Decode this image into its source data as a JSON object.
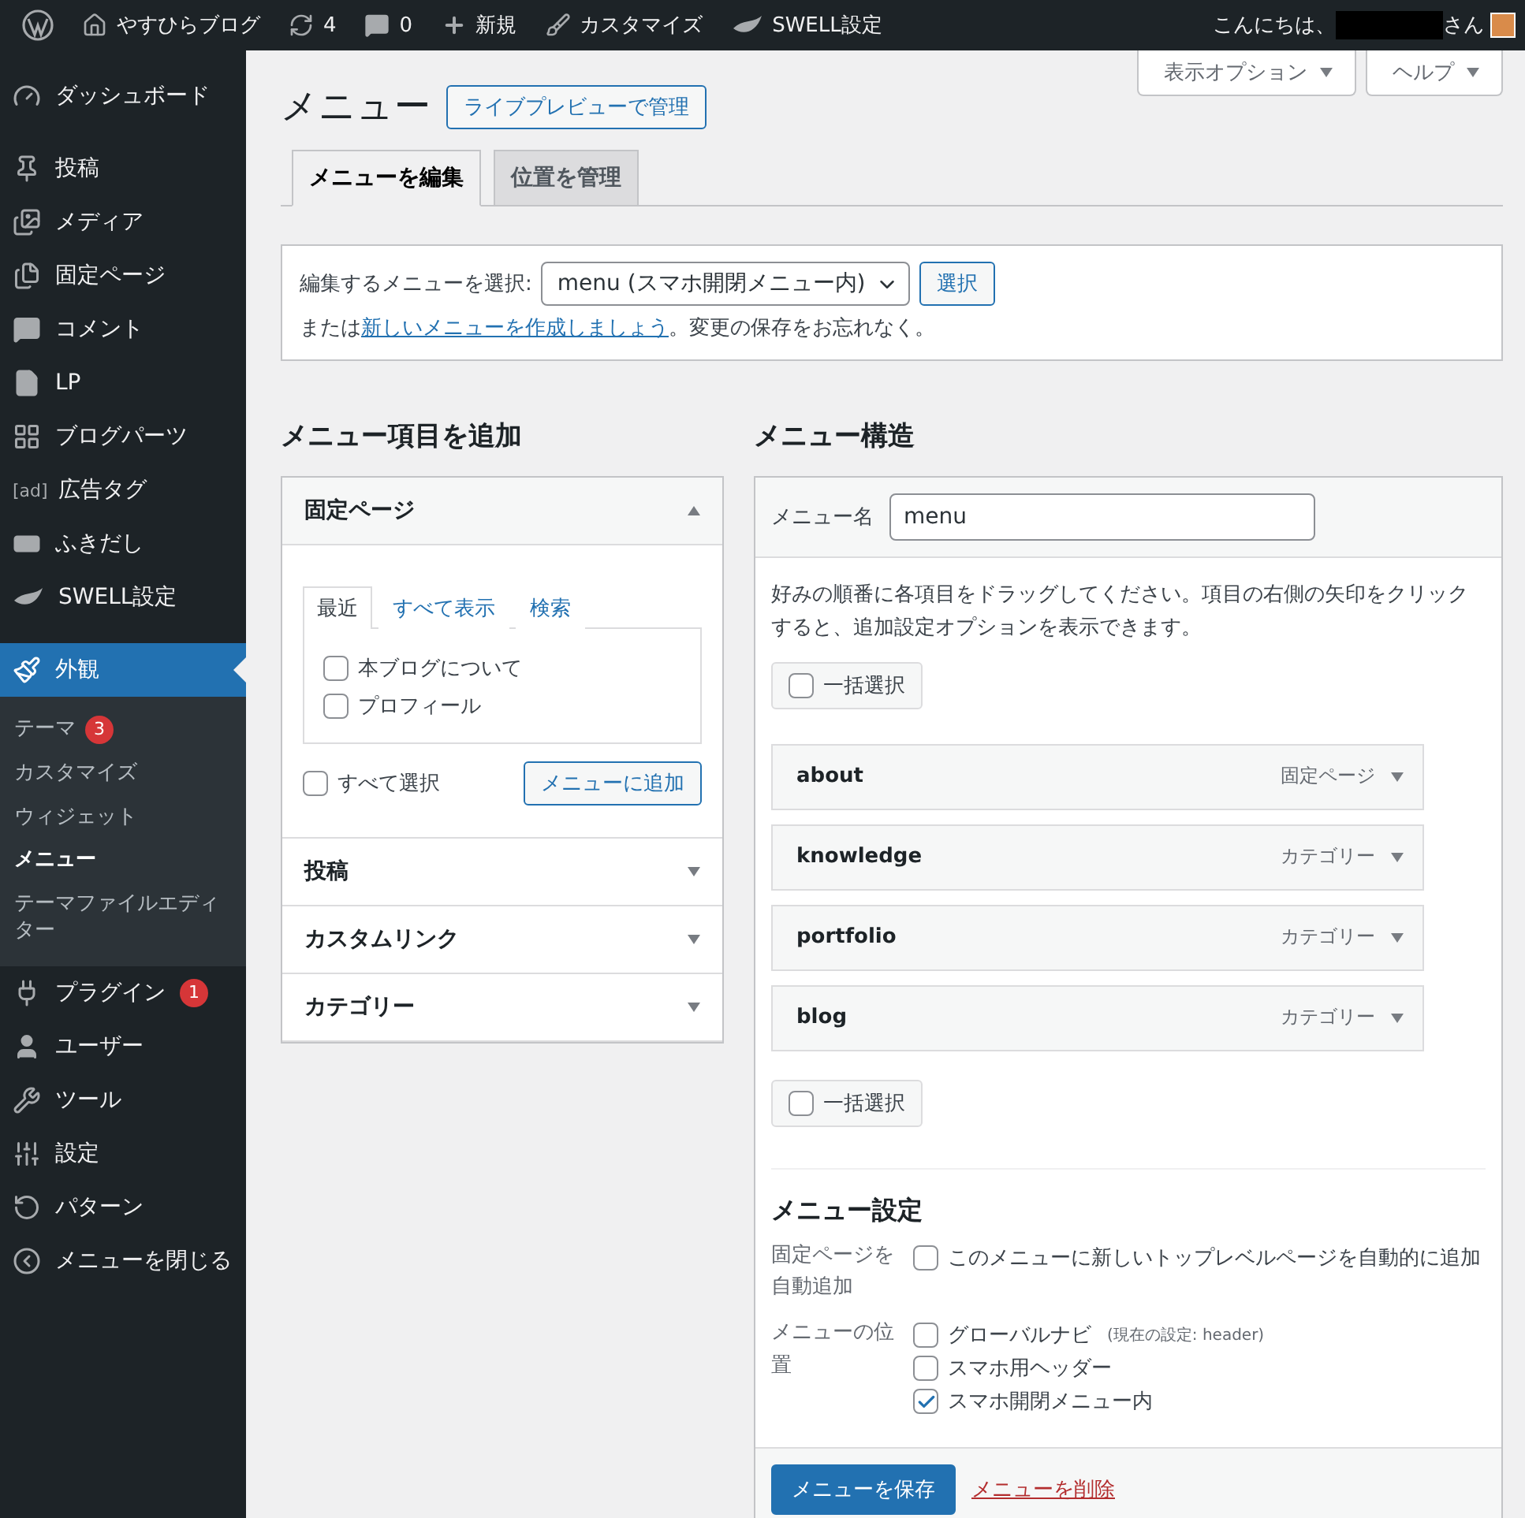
{
  "admin_bar": {
    "items": [
      {
        "kind": "site",
        "label": "やすひらブログ"
      },
      {
        "kind": "updates",
        "label": "4"
      },
      {
        "kind": "comments",
        "label": "0"
      },
      {
        "kind": "new",
        "label": "新規"
      },
      {
        "kind": "customize",
        "label": "カスタマイズ"
      },
      {
        "kind": "swell",
        "label": "SWELL設定"
      }
    ],
    "greeting": {
      "prefix": "こんにちは、",
      "suffix": "さん"
    }
  },
  "sidebar": {
    "sections": [
      {
        "items": [
          {
            "kind": "dashboard",
            "label": "ダッシュボード",
            "selected": false
          }
        ]
      },
      {
        "items": [
          {
            "kind": "posts",
            "label": "投稿",
            "selected": false
          },
          {
            "kind": "media",
            "label": "メディア",
            "selected": false
          },
          {
            "kind": "pages",
            "label": "固定ページ",
            "selected": false
          },
          {
            "kind": "comments",
            "label": "コメント",
            "selected": false
          },
          {
            "kind": "lp",
            "label": "LP",
            "selected": false
          },
          {
            "kind": "blog_parts",
            "label": "ブログパーツ",
            "selected": false
          },
          {
            "kind": "ad",
            "icon_text": "[ad]",
            "label": "広告タグ",
            "selected": false
          },
          {
            "kind": "balloon",
            "label": "ふきだし",
            "selected": false
          },
          {
            "kind": "swell",
            "label": "SWELL設定",
            "selected": false
          }
        ]
      },
      {
        "items": [
          {
            "kind": "appearance",
            "label": "外観",
            "selected": true,
            "children": [
              {
                "label": "テーマ",
                "badge": "3",
                "selected": false
              },
              {
                "label": "カスタマイズ",
                "selected": false
              },
              {
                "label": "ウィジェット",
                "selected": false
              },
              {
                "label": "メニュー",
                "selected": true
              },
              {
                "label": "テーマファイルエディター",
                "selected": false
              }
            ]
          },
          {
            "kind": "plugins",
            "label": "プラグイン",
            "badge": "1",
            "selected": false
          },
          {
            "kind": "users",
            "label": "ユーザー",
            "selected": false
          },
          {
            "kind": "tools",
            "label": "ツール",
            "selected": false
          },
          {
            "kind": "settings",
            "label": "設定",
            "selected": false
          },
          {
            "kind": "patterns",
            "label": "パターン",
            "selected": false
          },
          {
            "kind": "collapse",
            "label": "メニューを閉じる",
            "selected": false
          }
        ]
      }
    ]
  },
  "top_buttons": [
    "表示オプション",
    "ヘルプ"
  ],
  "page_title": "メニュー",
  "live_preview_button": "ライブプレビューで管理",
  "tabs": [
    {
      "label": "メニューを編集",
      "selected": true
    },
    {
      "label": "位置を管理",
      "selected": false
    }
  ],
  "select_panel": {
    "label": "編集するメニューを選択:",
    "select_value": "menu (スマホ開閉メニュー内)",
    "button": "選択",
    "note_prefix": "または",
    "note_link": "新しいメニューを作成しましょう",
    "note_suffix": "。変更の保存をお忘れなく。"
  },
  "add_items": {
    "heading": "メニュー項目を追加",
    "sections": [
      {
        "title": "固定ページ",
        "expanded": true,
        "tabs": [
          {
            "label": "最近",
            "selected": true
          },
          {
            "label": "すべて表示",
            "selected": false
          },
          {
            "label": "検索",
            "selected": false
          }
        ],
        "items": [
          {
            "label": "本ブログについて",
            "checked": false
          },
          {
            "label": "プロフィール",
            "checked": false
          }
        ],
        "select_all": {
          "label": "すべて選択",
          "checked": false
        },
        "add_button": "メニューに追加"
      },
      {
        "title": "投稿",
        "expanded": false
      },
      {
        "title": "カスタムリンク",
        "expanded": false
      },
      {
        "title": "カテゴリー",
        "expanded": false
      }
    ]
  },
  "structure": {
    "heading": "メニュー構造",
    "name_label": "メニュー名",
    "name_value": "menu",
    "instructions": "好みの順番に各項目をドラッグしてください。項目の右側の矢印をクリックすると、追加設定オプションを表示できます。",
    "bulk_select_top": {
      "label": "一括選択",
      "checked": false
    },
    "items": [
      {
        "title": "about",
        "type": "固定ページ"
      },
      {
        "title": "knowledge",
        "type": "カテゴリー"
      },
      {
        "title": "portfolio",
        "type": "カテゴリー"
      },
      {
        "title": "blog",
        "type": "カテゴリー"
      }
    ],
    "bulk_select_bottom": {
      "label": "一括選択",
      "checked": false
    },
    "settings_heading": "メニュー設定",
    "auto_add": {
      "label": "固定ページを自動追加",
      "option": "このメニューに新しいトップレベルページを自動的に追加",
      "checked": false
    },
    "locations": {
      "label": "メニューの位置",
      "options": [
        {
          "label": "グローバルナビ",
          "note": "(現在の設定: header)",
          "checked": false
        },
        {
          "label": "スマホ用ヘッダー",
          "checked": false
        },
        {
          "label": "スマホ開閉メニュー内",
          "checked": true
        }
      ]
    },
    "save_button": "メニューを保存",
    "delete_link": "メニューを削除"
  }
}
